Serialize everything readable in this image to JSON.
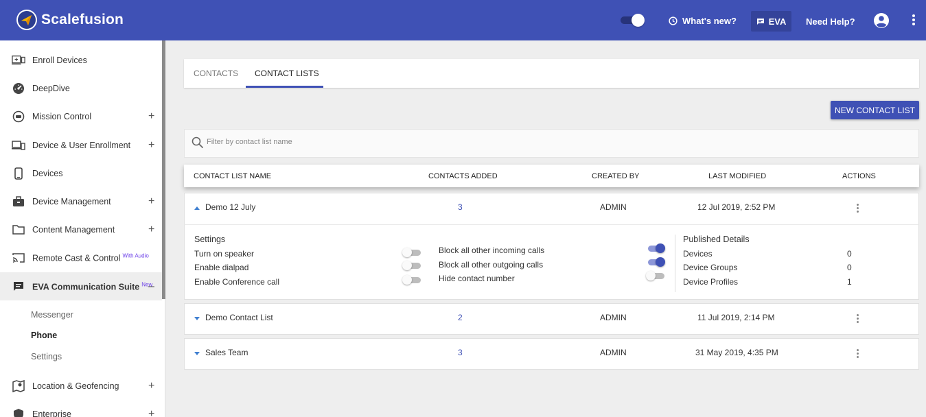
{
  "header": {
    "brand": "Scalefusion",
    "whats_new": "What's new?",
    "eva": "EVA",
    "need_help": "Need Help?"
  },
  "sidebar": {
    "items": [
      {
        "label": "Enroll Devices",
        "icon": "enroll-devices-icon",
        "expandable": false
      },
      {
        "label": "DeepDive",
        "icon": "speedometer-icon",
        "expandable": false
      },
      {
        "label": "Mission Control",
        "icon": "mission-control-icon",
        "expandable": true
      },
      {
        "label": "Device & User Enrollment",
        "icon": "devices-icon",
        "expandable": true
      },
      {
        "label": "Devices",
        "icon": "phone-icon",
        "expandable": false
      },
      {
        "label": "Device Management",
        "icon": "briefcase-icon",
        "expandable": true
      },
      {
        "label": "Content Management",
        "icon": "folder-icon",
        "expandable": true
      },
      {
        "label": "Remote Cast & Control",
        "badge": "With Audio",
        "icon": "cast-icon",
        "expandable": false
      },
      {
        "label": "EVA Communication Suite",
        "badge": "New",
        "icon": "chat-icon",
        "expanded": true
      },
      {
        "label": "Location & Geofencing",
        "icon": "map-icon",
        "expandable": true
      },
      {
        "label": "Enterprise",
        "icon": "shield-icon",
        "expandable": true
      }
    ],
    "sub_items": [
      "Messenger",
      "Phone",
      "Settings"
    ],
    "selected_sub_item": "Phone",
    "expand_symbol": "+",
    "collapse_symbol": "–"
  },
  "tabs": [
    {
      "label": "CONTACTS",
      "active": false
    },
    {
      "label": "CONTACT LISTS",
      "active": true
    }
  ],
  "new_button": "NEW CONTACT LIST",
  "filter": {
    "placeholder": "Filter by contact list name"
  },
  "table": {
    "columns": [
      "CONTACT LIST NAME",
      "CONTACTS ADDED",
      "CREATED BY",
      "LAST MODIFIED",
      "ACTIONS"
    ],
    "rows": [
      {
        "name": "Demo 12 July",
        "contacts": "3",
        "created_by": "ADMIN",
        "modified": "12 Jul 2019, 2:52 PM",
        "expanded": true
      },
      {
        "name": "Demo Contact List",
        "contacts": "2",
        "created_by": "ADMIN",
        "modified": "11 Jul 2019, 2:14 PM",
        "expanded": false
      },
      {
        "name": "Sales Team",
        "contacts": "3",
        "created_by": "ADMIN",
        "modified": "31 May 2019, 4:35 PM",
        "expanded": false
      }
    ]
  },
  "details": {
    "settings_title": "Settings",
    "settings_left": [
      {
        "label": "Turn on speaker",
        "on": false
      },
      {
        "label": "Enable dialpad",
        "on": false
      },
      {
        "label": "Enable Conference call",
        "on": false
      }
    ],
    "settings_right": [
      {
        "label": "Block all other incoming calls",
        "on": true
      },
      {
        "label": "Block all other outgoing calls",
        "on": true
      },
      {
        "label": "Hide contact number",
        "on": false
      }
    ],
    "published_title": "Published Details",
    "published": [
      {
        "label": "Devices",
        "value": "0"
      },
      {
        "label": "Device Groups",
        "value": "0"
      },
      {
        "label": "Device Profiles",
        "value": "1"
      }
    ]
  },
  "colors": {
    "primary": "#3f51b5",
    "link": "#3f51b5",
    "badge": "#6a3de8"
  }
}
